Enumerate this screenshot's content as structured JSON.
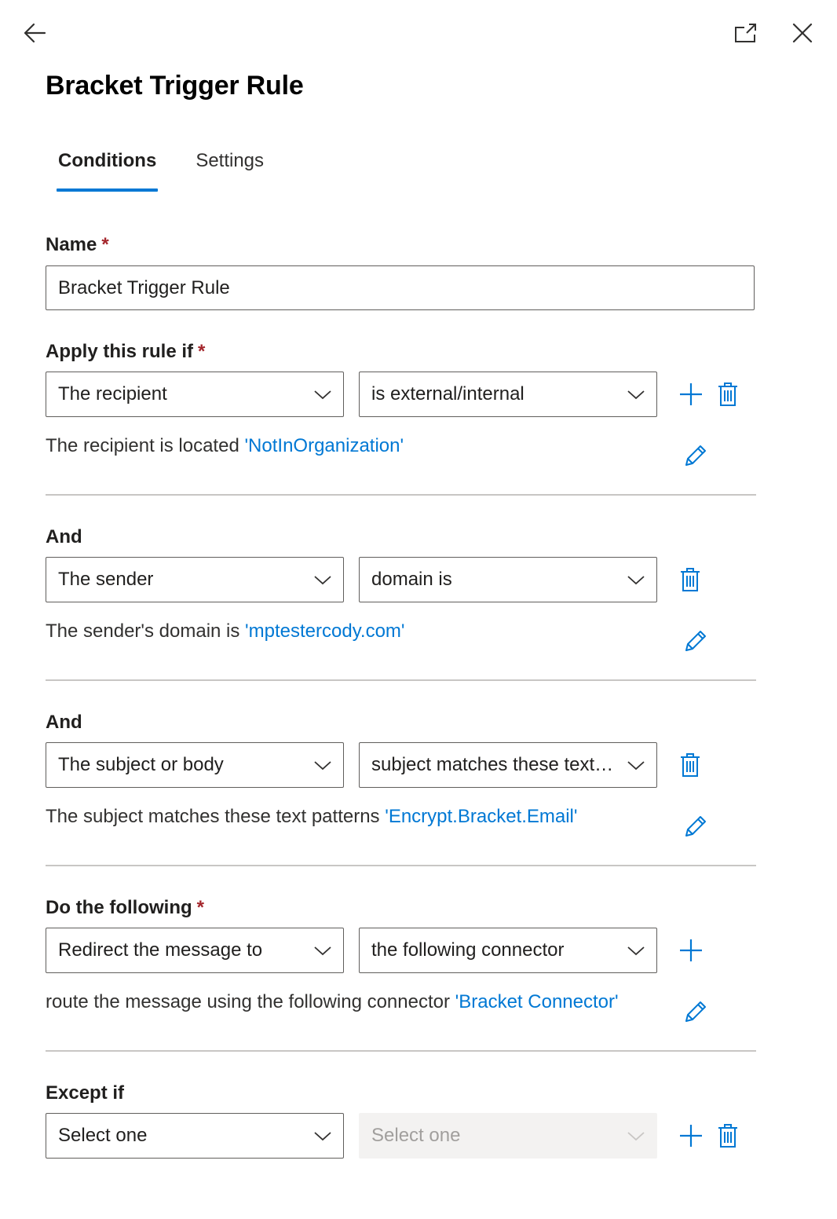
{
  "header": {
    "back_icon": "back-arrow-icon",
    "popout_icon": "popout-icon",
    "close_icon": "close-icon"
  },
  "title": "Bracket Trigger Rule",
  "tabs": [
    {
      "label": "Conditions",
      "active": true
    },
    {
      "label": "Settings",
      "active": false
    }
  ],
  "name_field": {
    "label": "Name",
    "required_mark": "*",
    "value": "Bracket Trigger Rule"
  },
  "conditions": [
    {
      "label": "Apply this rule if",
      "required_mark": "*",
      "dropdown1": "The recipient",
      "dropdown2": "is external/internal",
      "description": "The recipient is located ",
      "link": "'NotInOrganization'",
      "actions": [
        "add-icon",
        "delete-icon"
      ]
    },
    {
      "label": "And",
      "dropdown1": "The sender",
      "dropdown2": "domain is",
      "description": "The sender's domain is ",
      "link": "'mptestercody.com'",
      "actions": [
        "delete-icon"
      ]
    },
    {
      "label": "And",
      "dropdown1": "The subject or body",
      "dropdown2": "subject matches these text patterns",
      "description": "The subject matches these text patterns ",
      "link": "'Encrypt.Bracket.Email'",
      "actions": [
        "delete-icon"
      ]
    },
    {
      "label": "Do the following",
      "required_mark": "*",
      "dropdown1": "Redirect the message to",
      "dropdown2": "the following connector",
      "description": "route the message using the following connector ",
      "link": "'Bracket Connector'",
      "actions": [
        "add-icon"
      ]
    },
    {
      "label": "Except if",
      "dropdown1": "Select one",
      "dropdown2": "Select one",
      "dropdown2_disabled": true,
      "actions": [
        "add-icon",
        "delete-icon"
      ]
    }
  ],
  "colors": {
    "accent": "#0078d4",
    "required": "#a4262c",
    "border": "#605e5c",
    "divider": "#c8c6c4",
    "disabled_bg": "#f3f2f1"
  }
}
